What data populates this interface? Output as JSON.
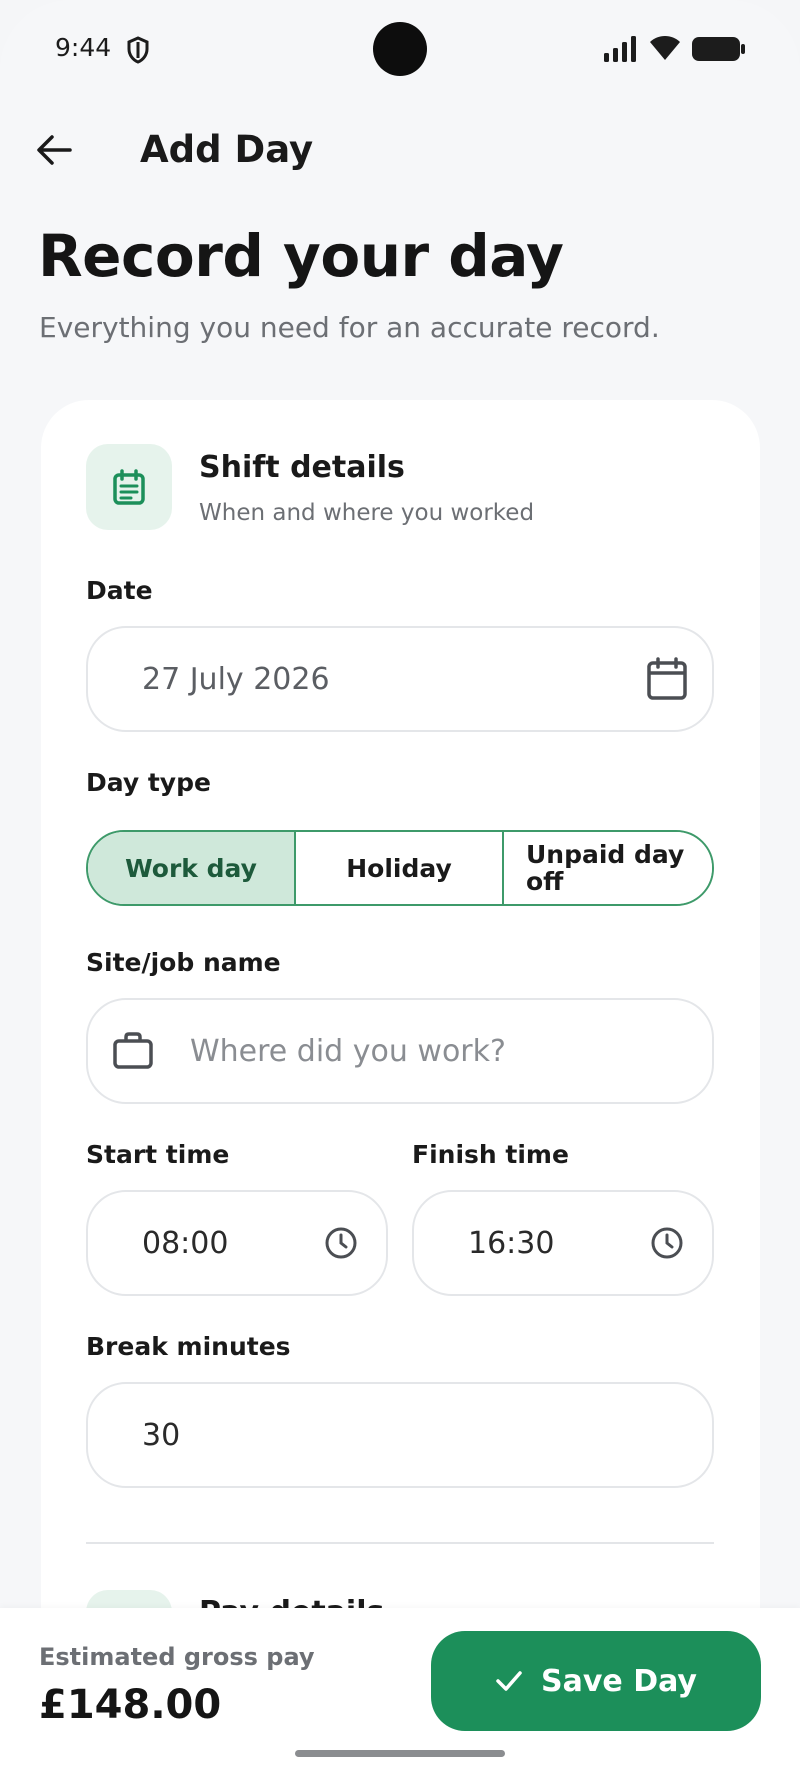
{
  "status_bar": {
    "time": "9:44"
  },
  "header": {
    "title": "Add Day"
  },
  "page": {
    "title": "Record your day",
    "subtitle": "Everything you need for an accurate record."
  },
  "shift_section": {
    "title": "Shift details",
    "subtitle": "When and where you worked"
  },
  "fields": {
    "date_label": "Date",
    "date_value": "27 July 2026",
    "day_type_label": "Day type",
    "day_types": [
      "Work day",
      "Holiday",
      "Unpaid day off"
    ],
    "day_type_selected": "Work day",
    "site_label": "Site/job name",
    "site_placeholder": "Where did you work?",
    "start_label": "Start time",
    "start_value": "08:00",
    "finish_label": "Finish time",
    "finish_value": "16:30",
    "break_label": "Break minutes",
    "break_value": "30"
  },
  "pay_section": {
    "title": "Pay details"
  },
  "footer": {
    "estimate_label": "Estimated gross pay",
    "estimate_value": "£148.00",
    "save_label": "Save Day"
  },
  "colors": {
    "accent": "#1c8f5a",
    "accent_light": "#cfe8da",
    "icon_bg": "#e6f3ec"
  }
}
